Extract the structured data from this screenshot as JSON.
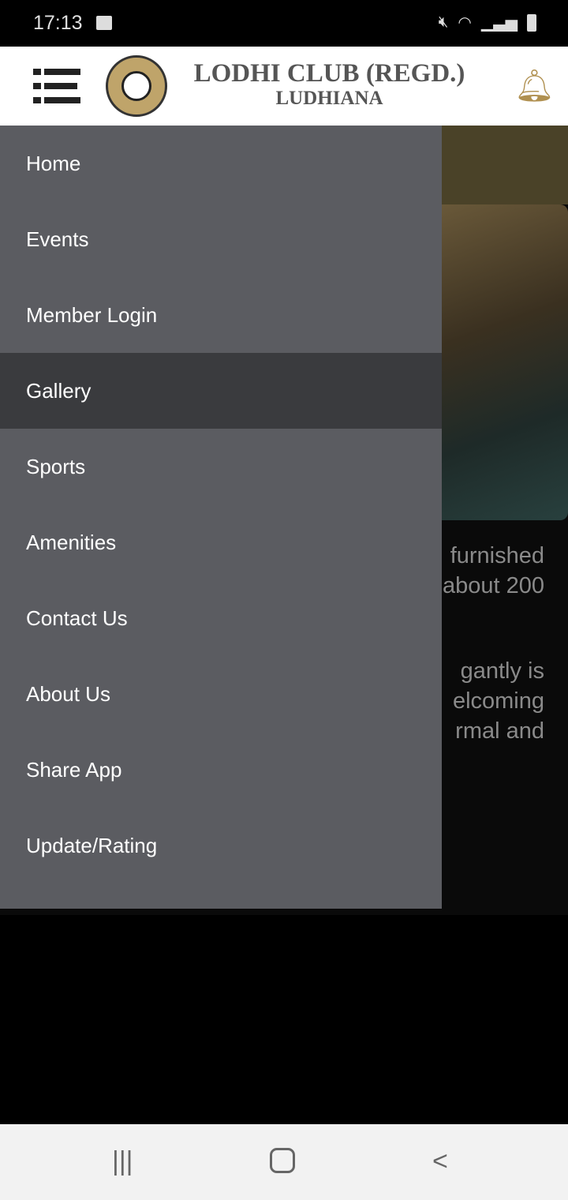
{
  "status_bar": {
    "time": "17:13",
    "icons": [
      "image-icon",
      "mute-icon",
      "wifi-icon",
      "signal-icon",
      "battery-icon"
    ]
  },
  "header": {
    "title": "LODHI CLUB (REGD.)",
    "subtitle": "LUDHIANA",
    "logo_text": "LODHI CLUB (REGD.) LUDHIANA",
    "accent": "#b09050"
  },
  "background_text": [
    "furnished",
    "about 200",
    "gantly is",
    "elcoming",
    "rmal and"
  ],
  "drawer": {
    "items": [
      {
        "label": "Home",
        "active": false
      },
      {
        "label": "Events",
        "active": false
      },
      {
        "label": "Member Login",
        "active": false
      },
      {
        "label": "Gallery",
        "active": true
      },
      {
        "label": "Sports",
        "active": false
      },
      {
        "label": "Amenities",
        "active": false
      },
      {
        "label": "Contact Us",
        "active": false
      },
      {
        "label": "About Us",
        "active": false
      },
      {
        "label": "Share App",
        "active": false
      },
      {
        "label": "Update/Rating",
        "active": false
      }
    ]
  },
  "nav_bar": {
    "icons": [
      "recent-apps-icon",
      "home-icon",
      "back-icon"
    ]
  }
}
